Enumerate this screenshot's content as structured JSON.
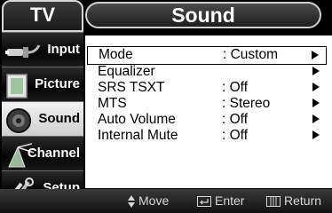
{
  "sidebar": {
    "header": "TV",
    "items": [
      {
        "label": "Input",
        "icon": "input-plug-icon",
        "active": false
      },
      {
        "label": "Picture",
        "icon": "picture-icon",
        "active": false
      },
      {
        "label": "Sound",
        "icon": "speaker-icon",
        "active": true
      },
      {
        "label": "Channel",
        "icon": "antenna-icon",
        "active": false
      },
      {
        "label": "Setup",
        "icon": "tools-icon",
        "active": false
      }
    ]
  },
  "panel": {
    "title": "Sound",
    "items": [
      {
        "label": "Mode",
        "value": ": Custom",
        "selected": true
      },
      {
        "label": "Equalizer",
        "value": ""
      },
      {
        "label": "SRS TSXT",
        "value": ": Off"
      },
      {
        "label": "MTS",
        "value": ": Stereo"
      },
      {
        "label": "Auto Volume",
        "value": ": Off"
      },
      {
        "label": "Internal Mute",
        "value": ": Off"
      }
    ]
  },
  "help": {
    "move": "Move",
    "enter": "Enter",
    "return": "Return"
  },
  "colors": {
    "panel_bg": "#ffffff",
    "sidebar_bg": "#000000",
    "active_tab": "#e6e6e6"
  }
}
